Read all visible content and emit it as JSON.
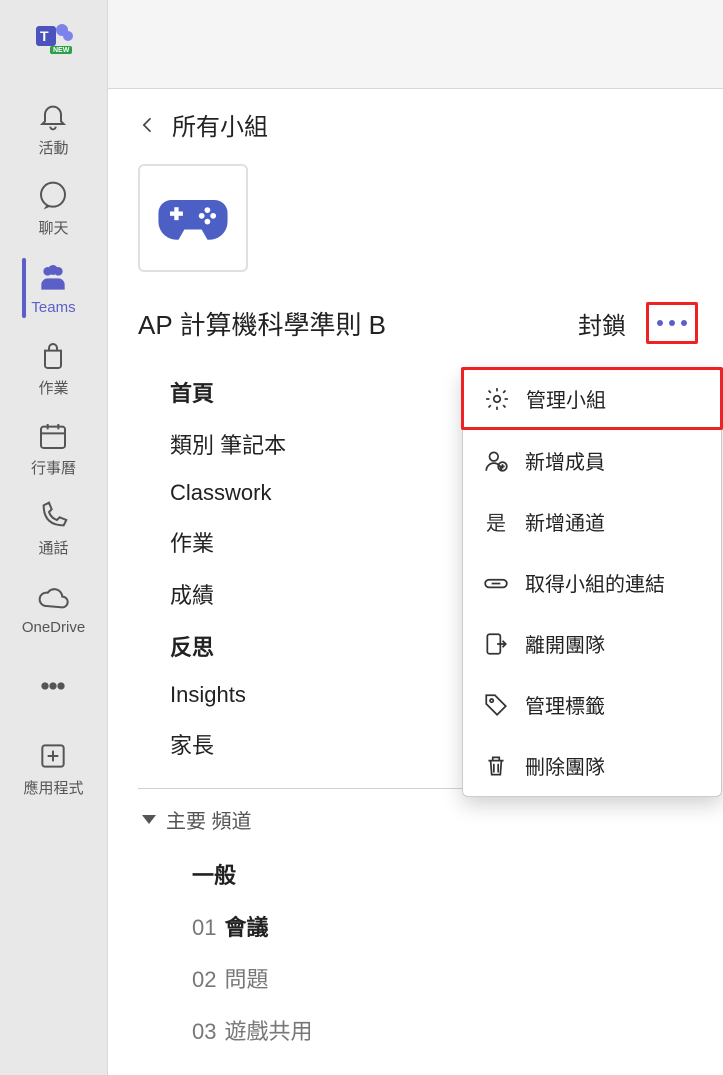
{
  "rail": [
    {
      "key": "activity",
      "label": "活動",
      "icon": "bell"
    },
    {
      "key": "chat",
      "label": "聊天",
      "icon": "chat"
    },
    {
      "key": "teams",
      "label": "Teams",
      "icon": "teams",
      "selected": true
    },
    {
      "key": "assign",
      "label": "作業",
      "icon": "bag"
    },
    {
      "key": "calendar",
      "label": "行事曆",
      "icon": "calendar"
    },
    {
      "key": "calls",
      "label": "通話",
      "icon": "phone"
    },
    {
      "key": "onedrive",
      "label": "OneDrive",
      "icon": "cloud"
    },
    {
      "key": "more",
      "label": "",
      "icon": "more"
    },
    {
      "key": "apps",
      "label": "應用程式",
      "icon": "apps"
    }
  ],
  "breadcrumb": {
    "label": "所有小組"
  },
  "team": {
    "name": "AP 計算機科學準則 B",
    "action": "封鎖",
    "tabs": [
      {
        "label": "首頁",
        "bold": true
      },
      {
        "label": "類別  筆記本"
      },
      {
        "label": "Classwork"
      },
      {
        "label": "作業"
      },
      {
        "label": "成績"
      },
      {
        "label": "反思",
        "bold": true
      },
      {
        "label": "Insights"
      },
      {
        "label": "家長"
      }
    ],
    "channel_section_label": "主要  頻道",
    "channels": [
      {
        "label": "一般",
        "bold": true
      },
      {
        "num": "01",
        "label": "會議",
        "bold": true
      },
      {
        "num": "02",
        "label": "問題"
      },
      {
        "num": "03",
        "label": "遊戲共用"
      }
    ]
  },
  "menu": [
    {
      "icon": "gear",
      "label": "管理小組",
      "highlight": true
    },
    {
      "icon": "addperson",
      "label": "新增成員"
    },
    {
      "icon": "channel",
      "label": "新增通道"
    },
    {
      "icon": "link",
      "label": "取得小組的連結"
    },
    {
      "icon": "leave",
      "label": "離開團隊"
    },
    {
      "icon": "tag",
      "label": "管理標籤"
    },
    {
      "icon": "trash",
      "label": "刪除團隊"
    }
  ]
}
